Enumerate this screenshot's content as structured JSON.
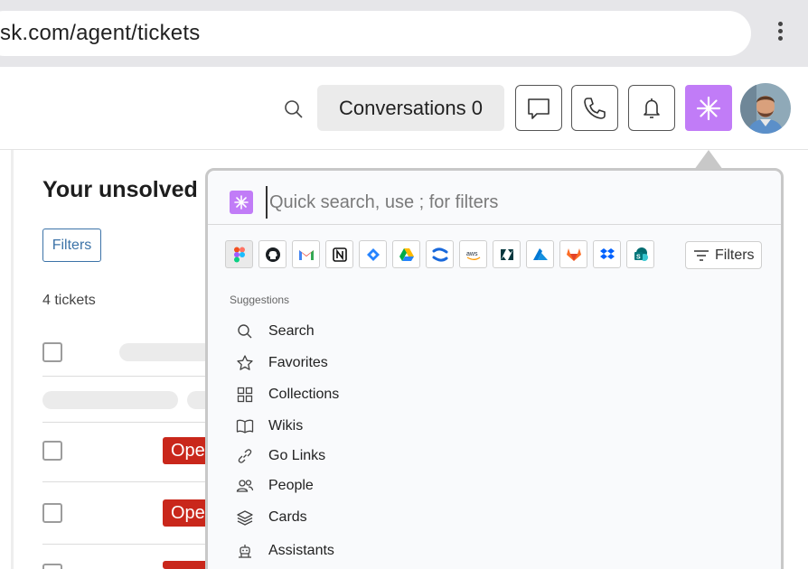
{
  "browser": {
    "url": "sk.com/agent/tickets"
  },
  "header": {
    "conversations_label": "Conversations 0"
  },
  "main": {
    "heading": "Your unsolved",
    "filters_label": "Filters",
    "ticket_count": "4 tickets",
    "status_badge": "Open"
  },
  "quick_search": {
    "placeholder": "Quick search, use ; for filters",
    "filters_label": "Filters",
    "apps": [
      "figma-icon",
      "github-icon",
      "gmail-icon",
      "notion-icon",
      "jira-icon",
      "google-drive-icon",
      "confluence-icon",
      "aws-icon",
      "zendesk-icon",
      "azure-icon",
      "gitlab-icon",
      "dropbox-icon",
      "sharepoint-icon"
    ],
    "suggestions_label": "Suggestions",
    "suggestions": [
      {
        "label": "Search",
        "icon": "search-icon"
      },
      {
        "label": "Favorites",
        "icon": "star-icon"
      },
      {
        "label": "Collections",
        "icon": "grid-icon"
      },
      {
        "label": "Wikis",
        "icon": "book-icon"
      },
      {
        "label": "Go Links",
        "icon": "link-icon"
      },
      {
        "label": "People",
        "icon": "people-icon"
      },
      {
        "label": "Cards",
        "icon": "layers-icon"
      },
      {
        "label": "Assistants",
        "icon": "assistant-icon"
      }
    ]
  },
  "colors": {
    "accent": "#c17cf7",
    "badge": "#c9271b",
    "link": "#3c73a8"
  }
}
